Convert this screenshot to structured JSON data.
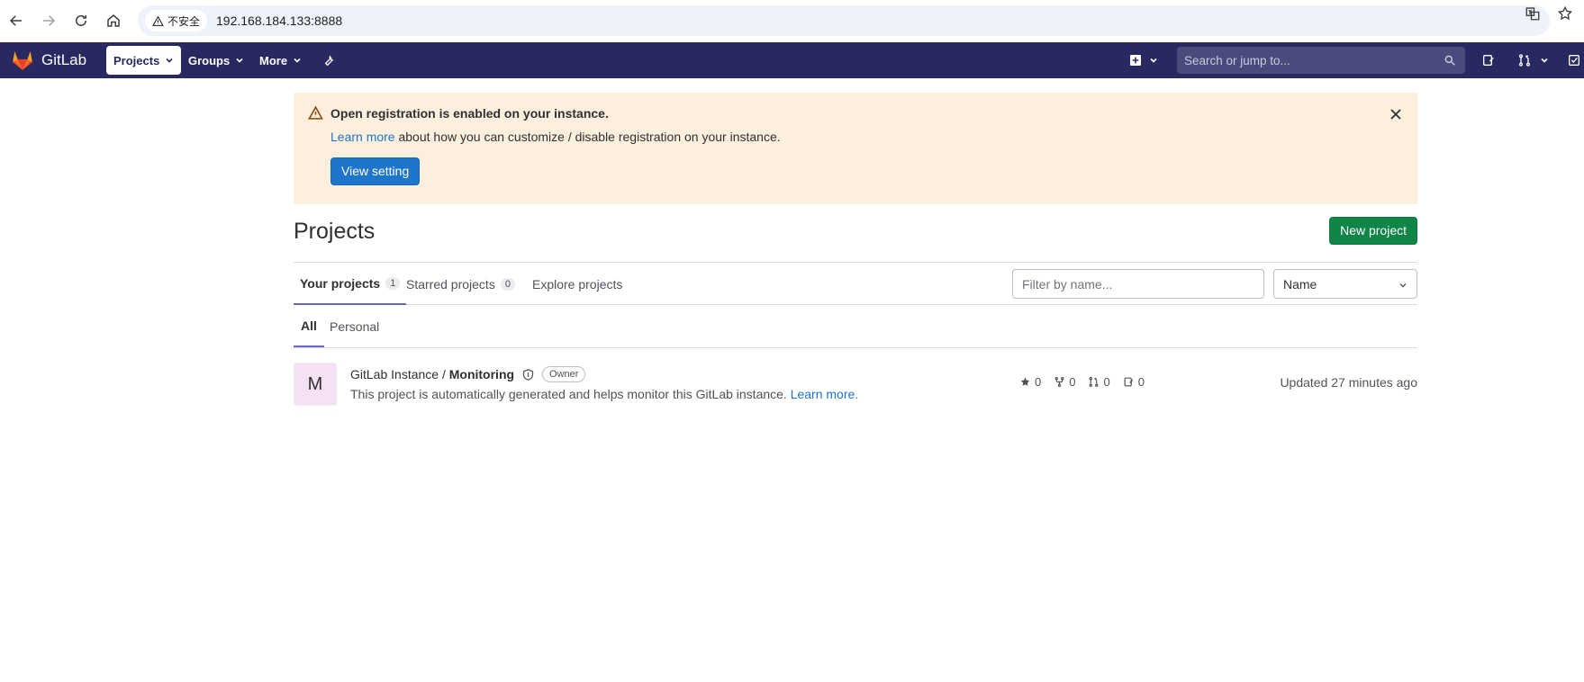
{
  "browser": {
    "insecure_label": "不安全",
    "url": "192.168.184.133:8888"
  },
  "navbar": {
    "brand": "GitLab",
    "items": [
      {
        "label": "Projects"
      },
      {
        "label": "Groups"
      },
      {
        "label": "More"
      }
    ],
    "search_placeholder": "Search or jump to..."
  },
  "alert": {
    "title": "Open registration is enabled on your instance.",
    "learn_more": "Learn more",
    "body": "about how you can customize / disable registration on your instance.",
    "button": "View setting"
  },
  "page": {
    "title": "Projects",
    "new_project": "New project"
  },
  "tabs": [
    {
      "label": "Your projects",
      "count": "1"
    },
    {
      "label": "Starred projects",
      "count": "0"
    },
    {
      "label": "Explore projects"
    }
  ],
  "filter": {
    "placeholder": "Filter by name...",
    "sort_value": "Name"
  },
  "subtabs": [
    {
      "label": "All"
    },
    {
      "label": "Personal"
    }
  ],
  "project": {
    "avatar_letter": "M",
    "namespace": "GitLab Instance / ",
    "name": "Monitoring",
    "role": "Owner",
    "description": "This project is automatically generated and helps monitor this GitLab instance.",
    "learn_more": "Learn more.",
    "stars": "0",
    "forks": "0",
    "merge_requests": "0",
    "issues": "0",
    "updated": "Updated 27 minutes ago"
  },
  "colors": {
    "navbar": "#292961",
    "primary": "#1f75cb",
    "success": "#108548",
    "alert_bg": "#fdefdd"
  }
}
